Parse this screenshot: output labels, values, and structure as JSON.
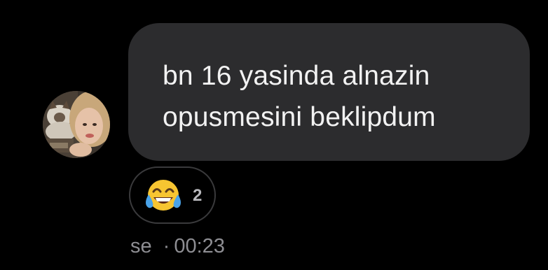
{
  "message": {
    "lines": [
      "bn 16 yasinda alnazin",
      "opusmesini beklipdum"
    ]
  },
  "reaction": {
    "emoji_icon": "face-with-tears-of-joy-icon",
    "count": "2"
  },
  "meta": {
    "sender": "se",
    "separator": "·",
    "time": "00:23"
  },
  "colors": {
    "background": "#000000",
    "bubble": "#2c2c2e",
    "text": "#f2f2f2",
    "secondary_text": "#8e8e93"
  }
}
